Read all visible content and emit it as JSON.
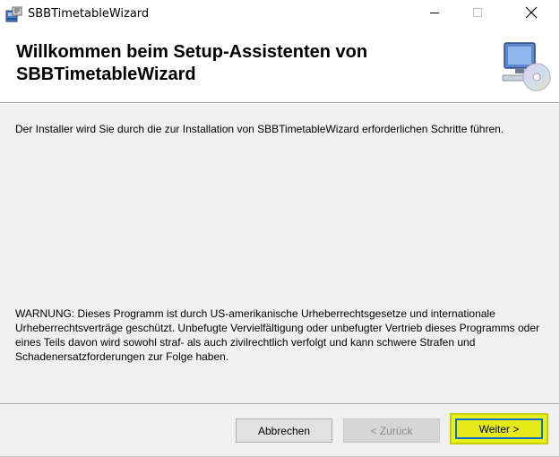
{
  "window": {
    "title": "SBBTimetableWizard",
    "app_icon": "installer-package-icon",
    "controls": {
      "minimize_icon": "minimize-icon",
      "maximize_icon": "maximize-icon",
      "close_icon": "close-icon"
    }
  },
  "header": {
    "title": "Willkommen beim Setup-Assistenten von SBBTimetableWizard",
    "icon": "computer-disc-icon"
  },
  "body": {
    "intro": "Der Installer wird Sie durch die zur Installation von SBBTimetableWizard erforderlichen Schritte führen.",
    "warning": "WARNUNG: Dieses Programm ist durch US-amerikanische Urheberrechtsgesetze und internationale Urheberrechtsverträge geschützt. Unbefugte Vervielfältigung oder unbefugter Vertrieb dieses Programms oder eines Teils davon wird sowohl straf- als auch zivilrechtlich verfolgt und kann schwere Strafen und Schadenersatzforderungen zur Folge haben."
  },
  "buttons": {
    "cancel": "Abbrechen",
    "back": "< Zurück",
    "next": "Weiter >"
  },
  "colors": {
    "highlight": "#e8f01a",
    "focus_border": "#0a6fc4",
    "disabled_text": "#8a8a8a"
  }
}
